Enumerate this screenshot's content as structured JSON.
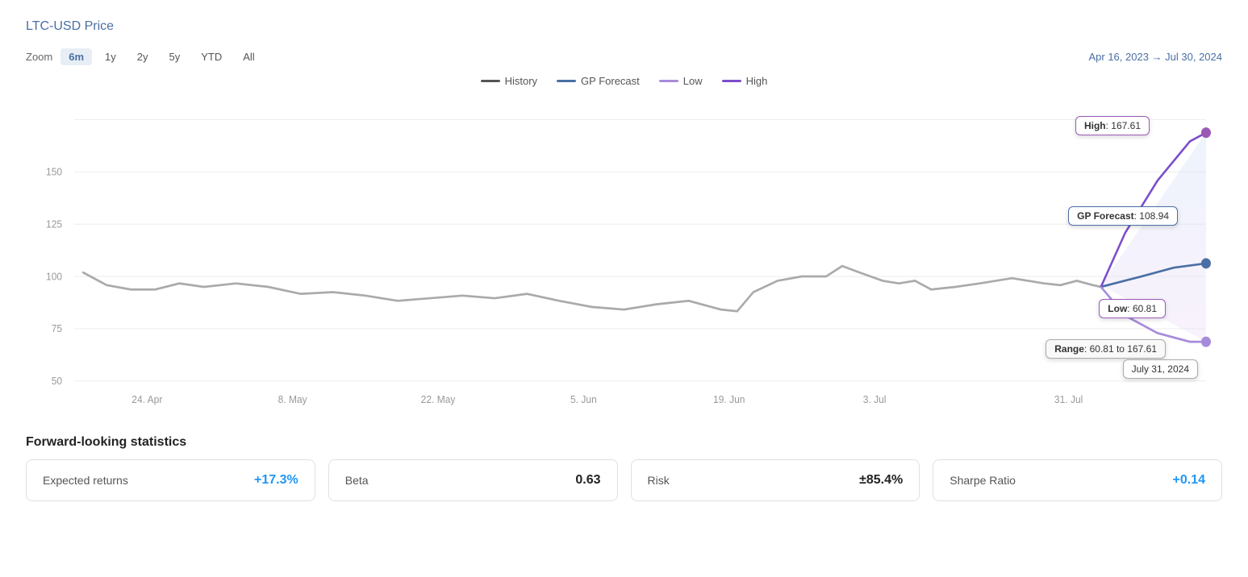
{
  "title": "LTC-USD Price",
  "zoom": {
    "label": "Zoom",
    "buttons": [
      "6m",
      "1y",
      "2y",
      "5y",
      "YTD",
      "All"
    ],
    "active": "6m"
  },
  "dateRange": "Apr 16, 2023 → Jul 30, 2024",
  "legend": [
    {
      "id": "history",
      "label": "History",
      "class": "history"
    },
    {
      "id": "gp",
      "label": "GP Forecast",
      "class": "gp"
    },
    {
      "id": "low",
      "label": "Low",
      "class": "low"
    },
    {
      "id": "high",
      "label": "High",
      "class": "high"
    }
  ],
  "tooltips": {
    "high": "High: 167.61",
    "gp": "GP Forecast: 108.94",
    "low": "Low: 60.81",
    "range": "Range: 60.81 to 167.61",
    "date": "July 31, 2024"
  },
  "yAxis": [
    "150",
    "125",
    "100",
    "75",
    "50"
  ],
  "xAxis": [
    "24. Apr",
    "8. May",
    "22. May",
    "5. Jun",
    "19. Jun",
    "3. Jul",
    "31. Jul"
  ],
  "stats": {
    "title": "Forward-looking statistics",
    "cards": [
      {
        "label": "Expected returns",
        "value": "+17.3%",
        "positive": true
      },
      {
        "label": "Beta",
        "value": "0.63",
        "positive": false
      },
      {
        "label": "Risk",
        "value": "±85.4%",
        "positive": false
      },
      {
        "label": "Sharpe Ratio",
        "value": "+0.14",
        "positive": true
      }
    ]
  }
}
